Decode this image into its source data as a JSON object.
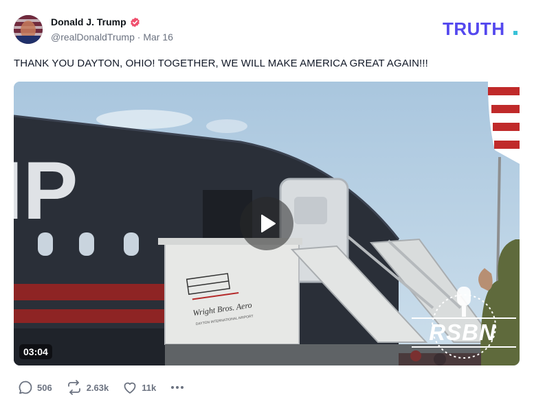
{
  "author": {
    "display_name": "Donald J. Trump",
    "handle": "@realDonaldTrump",
    "date_sep": "·",
    "date": "Mar 16",
    "verified": true
  },
  "brand": {
    "logo_text": "TRUTH",
    "colors": {
      "primary": "#5448ee",
      "accent": "#39c2d8"
    }
  },
  "post": {
    "text": "THANK YOU DAYTON, OHIO! TOGETHER, WE WILL MAKE AMERICA GREAT AGAIN!!!"
  },
  "media": {
    "type": "video",
    "duration": "03:04",
    "watermark": "RSBN",
    "scene_text": {
      "plane_partial_letters": "IP",
      "stair_sign": "Wright Bros. Aero",
      "stair_sign_small": "DAYTON INTERNATIONAL AIRPORT"
    }
  },
  "actions": {
    "replies": "506",
    "retruths": "2.63k",
    "likes": "11k",
    "more_icon": "ellipsis-icon"
  },
  "colors": {
    "verified_badge": "#f0506e",
    "muted_text": "#6b7280",
    "icon_gray": "#6b7280"
  }
}
